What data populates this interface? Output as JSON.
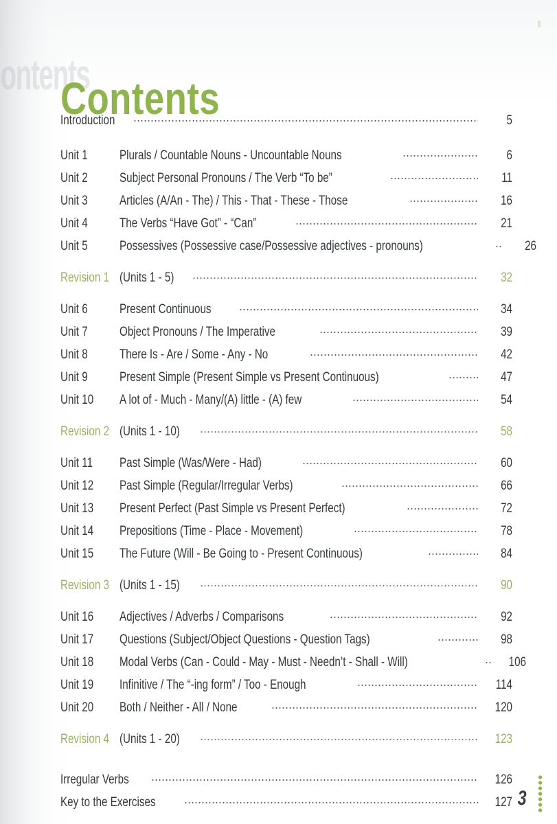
{
  "document": {
    "title": "Contents",
    "ghost_text": "Contents",
    "footer_page_number": "3"
  },
  "colors": {
    "title_green": "#8fb44e",
    "revision_green": "#9cb064",
    "body_text": "#34393c",
    "leader_dots": "#55595c",
    "page_background": "#ffffff"
  },
  "toc": {
    "front_matter": [
      {
        "label": "Introduction",
        "description": "",
        "page": "5",
        "kind": "wide"
      }
    ],
    "groups": [
      {
        "entries": [
          {
            "label": "Unit 1",
            "description": "Plurals / Countable Nouns - Uncountable Nouns",
            "page": "6",
            "kind": "unit"
          },
          {
            "label": "Unit 2",
            "description": "Subject Personal Pronouns / The Verb “To be”",
            "page": "11",
            "kind": "unit"
          },
          {
            "label": "Unit 3",
            "description": "Articles (A/An - The) / This - That - These - Those",
            "page": "16",
            "kind": "unit"
          },
          {
            "label": "Unit 4",
            "description": "The Verbs “Have Got” - “Can”",
            "page": "21",
            "kind": "unit"
          },
          {
            "label": "Unit 5",
            "description": "Possessives (Possessive case/Possessive adjectives - pronouns)",
            "page": "26",
            "kind": "unit"
          }
        ],
        "revision": {
          "label": "Revision 1",
          "description": "(Units 1 - 5)",
          "page": "32",
          "kind": "revision"
        }
      },
      {
        "entries": [
          {
            "label": "Unit 6",
            "description": "Present Continuous",
            "page": "34",
            "kind": "unit"
          },
          {
            "label": "Unit 7",
            "description": "Object Pronouns / The Imperative",
            "page": "39",
            "kind": "unit"
          },
          {
            "label": "Unit 8",
            "description": "There Is - Are / Some - Any - No",
            "page": "42",
            "kind": "unit"
          },
          {
            "label": "Unit 9",
            "description": "Present Simple (Present Simple vs Present Continuous)",
            "page": "47",
            "kind": "unit"
          },
          {
            "label": "Unit 10",
            "description": "A lot of - Much - Many/(A) little - (A) few",
            "page": "54",
            "kind": "unit"
          }
        ],
        "revision": {
          "label": "Revision 2",
          "description": "(Units 1 - 10)",
          "page": "58",
          "kind": "revision"
        }
      },
      {
        "entries": [
          {
            "label": "Unit 11",
            "description": "Past Simple (Was/Were - Had)",
            "page": "60",
            "kind": "unit"
          },
          {
            "label": "Unit 12",
            "description": "Past Simple (Regular/Irregular Verbs)",
            "page": "66",
            "kind": "unit"
          },
          {
            "label": "Unit 13",
            "description": "Present Perfect (Past Simple vs Present Perfect)",
            "page": "72",
            "kind": "unit"
          },
          {
            "label": "Unit 14",
            "description": "Prepositions (Time - Place - Movement)",
            "page": "78",
            "kind": "unit"
          },
          {
            "label": "Unit 15",
            "description": "The Future (Will - Be Going to - Present Continuous)",
            "page": "84",
            "kind": "unit"
          }
        ],
        "revision": {
          "label": "Revision 3",
          "description": "(Units 1 - 15)",
          "page": "90",
          "kind": "revision"
        }
      },
      {
        "entries": [
          {
            "label": "Unit 16",
            "description": "Adjectives / Adverbs / Comparisons",
            "page": "92",
            "kind": "unit"
          },
          {
            "label": "Unit 17",
            "description": "Questions (Subject/Object Questions - Question Tags)",
            "page": "98",
            "kind": "unit"
          },
          {
            "label": "Unit 18",
            "description": "Modal Verbs (Can - Could - May - Must - Needn’t - Shall - Will)",
            "page": "106",
            "kind": "unit"
          },
          {
            "label": "Unit 19",
            "description": "Infinitive / The “-ing form” / Too - Enough",
            "page": "114",
            "kind": "unit"
          },
          {
            "label": "Unit 20",
            "description": "Both / Neither - All / None",
            "page": "120",
            "kind": "unit"
          }
        ],
        "revision": {
          "label": "Revision 4",
          "description": "(Units 1 - 20)",
          "page": "123",
          "kind": "revision"
        }
      }
    ],
    "back_matter": [
      {
        "label": "Irregular Verbs",
        "description": "",
        "page": "126",
        "kind": "wide"
      },
      {
        "label": "Key to the Exercises",
        "description": "",
        "page": "127",
        "kind": "wide"
      }
    ]
  }
}
